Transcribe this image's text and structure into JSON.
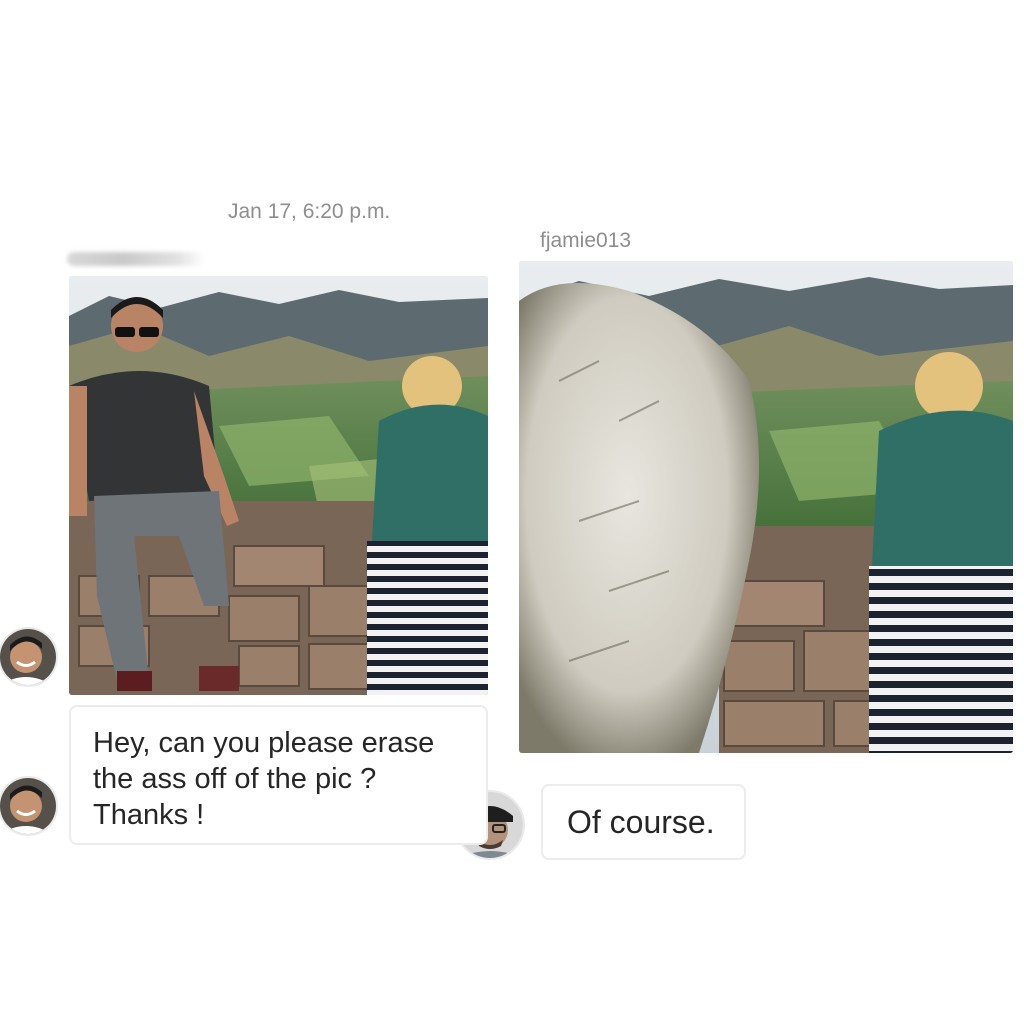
{
  "thread": {
    "timestamp": "Jan 17, 6:20 p.m.",
    "sender_name_redacted": true
  },
  "reply_author": {
    "username": "fjamie013"
  },
  "messages": [
    {
      "sender": "user",
      "type": "photo",
      "description": "original photo"
    },
    {
      "sender": "user",
      "type": "text",
      "lines": [
        "Hey, can you please erase",
        "the ass off of the pic ?",
        "Thanks !"
      ]
    },
    {
      "sender": "fjamie013",
      "type": "photo",
      "description": "edited photo"
    },
    {
      "sender": "fjamie013",
      "type": "text",
      "text": "Of course."
    }
  ],
  "colors": {
    "meta_text": "#8e8e8e",
    "bubble_text": "#262626",
    "bubble_border": "#ececec"
  }
}
